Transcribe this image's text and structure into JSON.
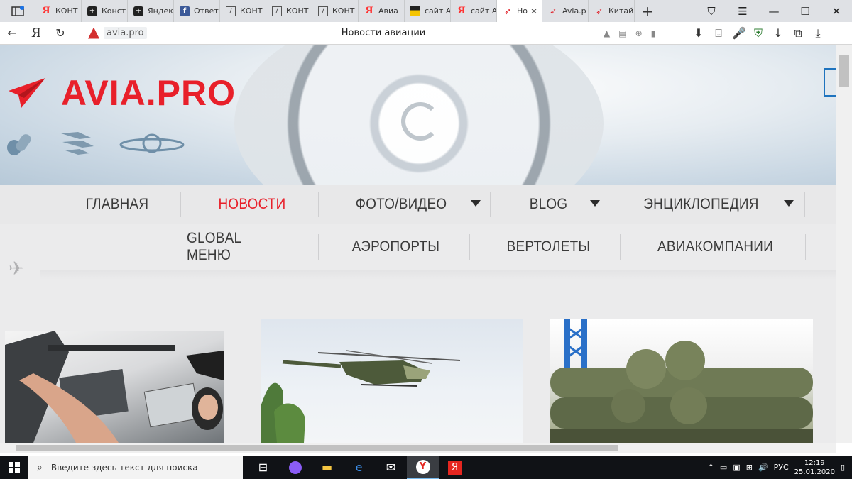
{
  "browser": {
    "tabs": [
      {
        "title": "КОНТ",
        "icon": "yandex-icon"
      },
      {
        "title": "Конст",
        "icon": "plus-icon"
      },
      {
        "title": "Яндек",
        "icon": "plus-icon"
      },
      {
        "title": "Ответ",
        "icon": "facebook-icon"
      },
      {
        "title": "КОНТ",
        "icon": "document-icon"
      },
      {
        "title": "КОНТ",
        "icon": "document-icon"
      },
      {
        "title": "КОНТ",
        "icon": "document-icon"
      },
      {
        "title": "Авиа",
        "icon": "yandex-icon"
      },
      {
        "title": "сайт А",
        "icon": "image-icon"
      },
      {
        "title": "сайт А",
        "icon": "yandex-icon"
      },
      {
        "title": "Но",
        "icon": "avia-icon",
        "active": true
      },
      {
        "title": "Avia.p",
        "icon": "avia-icon"
      },
      {
        "title": "Китай",
        "icon": "avia-icon"
      }
    ],
    "address": {
      "url": "avia.pro",
      "page_title": "Новости авиации"
    }
  },
  "site": {
    "logo_text": "AVIA.PRO",
    "brand_color": "#e8202a",
    "menu_primary": [
      {
        "label": "ГЛАВНАЯ",
        "active": false,
        "dropdown": false
      },
      {
        "label": "НОВОСТИ",
        "active": true,
        "dropdown": false
      },
      {
        "label": "ФОТО/ВИДЕО",
        "active": false,
        "dropdown": true
      },
      {
        "label": "BLOG",
        "active": false,
        "dropdown": true
      },
      {
        "label": "ЭНЦИКЛОПЕДИЯ",
        "active": false,
        "dropdown": true
      }
    ],
    "menu_secondary": [
      {
        "label": "GLOBAL МЕНЮ"
      },
      {
        "label": "АЭРОПОРТЫ"
      },
      {
        "label": "ВЕРТОЛЕТЫ"
      },
      {
        "label": "АВИАКОМПАНИИ"
      }
    ]
  },
  "taskbar": {
    "search_placeholder": "Введите здесь текст для поиска",
    "language": "РУС",
    "time": "12:19",
    "date": "25.01.2020"
  }
}
